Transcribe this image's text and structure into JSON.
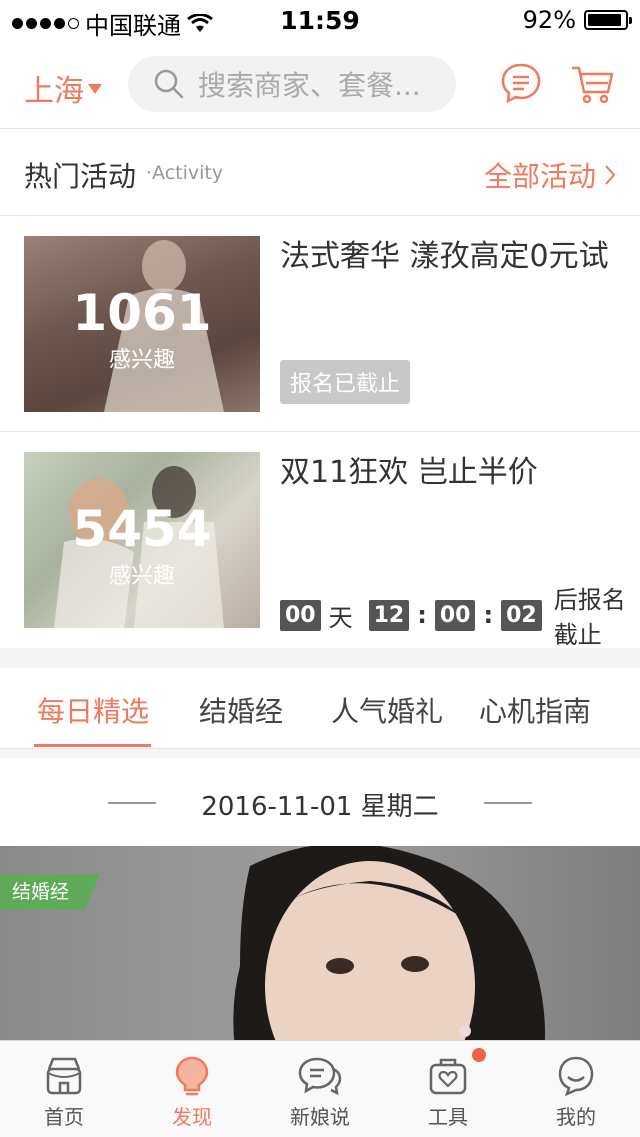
{
  "status_bar": {
    "carrier": "中国联通",
    "time": "11:59",
    "battery": "92%",
    "battery_level": 0.92
  },
  "header": {
    "city": "上海",
    "search_placeholder": "搜索商家、套餐..."
  },
  "hot_section": {
    "title": "热门活动",
    "subtitle": "·Activity",
    "all_label": "全部活动"
  },
  "activities": [
    {
      "count": "1061",
      "count_label": "感兴趣",
      "title": "法式奢华 漾孜高定0元试",
      "status": "报名已截止"
    },
    {
      "count": "5454",
      "count_label": "感兴趣",
      "title": "双11狂欢 岂止半价",
      "countdown": {
        "days": "00",
        "day_unit": "天",
        "hours": "12",
        "minutes": "00",
        "seconds": "02",
        "sep": ":",
        "suffix": "后报名截止"
      }
    }
  ],
  "tabs": [
    {
      "label": "每日精选",
      "active": true
    },
    {
      "label": "结婚经",
      "active": false
    },
    {
      "label": "人气婚礼",
      "active": false
    },
    {
      "label": "心机指南",
      "active": false
    }
  ],
  "date_header": "2016-11-01 星期二",
  "banner": {
    "tag": "结婚经"
  },
  "bottom_nav": [
    {
      "label": "首页",
      "icon": "home-icon"
    },
    {
      "label": "发现",
      "icon": "bulb-icon"
    },
    {
      "label": "新娘说",
      "icon": "chat-icon"
    },
    {
      "label": "工具",
      "icon": "toolbox-icon"
    },
    {
      "label": "我的",
      "icon": "profile-icon"
    }
  ],
  "colors": {
    "accent": "#ef7a5d",
    "tag_green": "#5eaa58",
    "notification": "#f0614b"
  }
}
